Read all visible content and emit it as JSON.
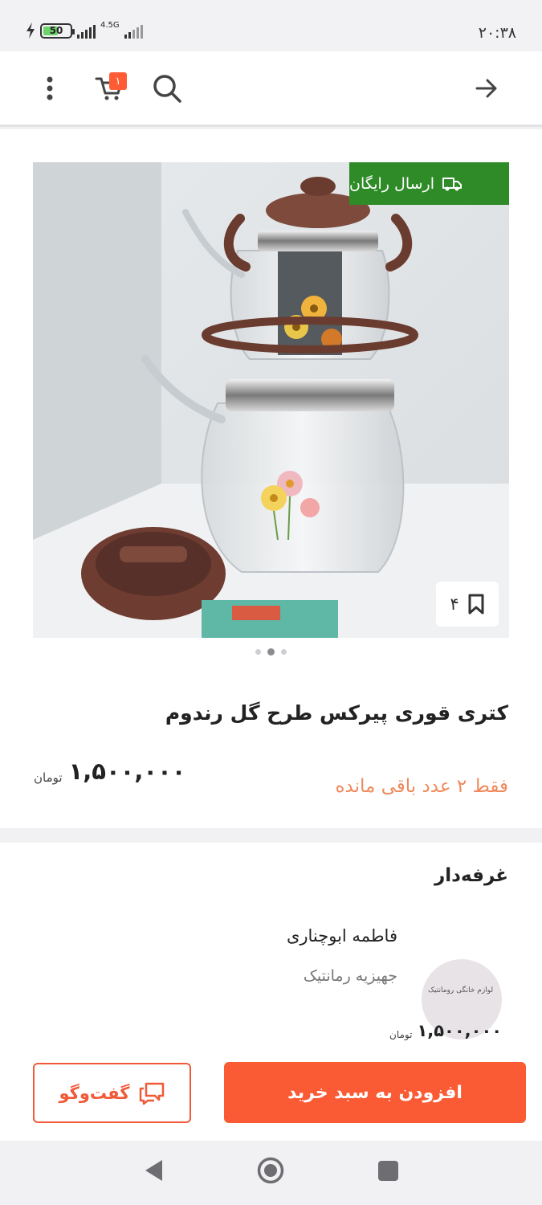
{
  "status_bar": {
    "battery_level": "50",
    "network_label": "4.5G",
    "time": "۲۰:۳۸"
  },
  "top_bar": {
    "cart_count": "۱",
    "icons": [
      "more-vertical-icon",
      "cart-icon",
      "search-icon",
      "arrow-right-icon"
    ]
  },
  "product": {
    "free_shipping_label": "ارسال رایگان",
    "bookmark_count": "۴",
    "image_count": 3,
    "active_image_index": 1,
    "title": "کتری قوری پیرکس طرح گل رندوم",
    "price": "۱,۵۰۰,۰۰۰",
    "currency": "تومان",
    "stock_note": "فقط ۲ عدد باقی مانده"
  },
  "seller": {
    "heading": "غرفه‌دار",
    "name": "فاطمه ابوچناری",
    "shop_name": "جهیزیه رمانتیک",
    "avatar_text": "لوازم خانگی رومانتیک",
    "price": "۱,۵۰۰,۰۰۰",
    "currency": "تومان"
  },
  "actions": {
    "add_to_cart_label": "افزودن به سبد خرید",
    "chat_label": "گفت‌وگو"
  },
  "colors": {
    "accent": "#fa5a34",
    "free_shipping": "#2e8b28",
    "stock_warning": "#f08a5d"
  }
}
